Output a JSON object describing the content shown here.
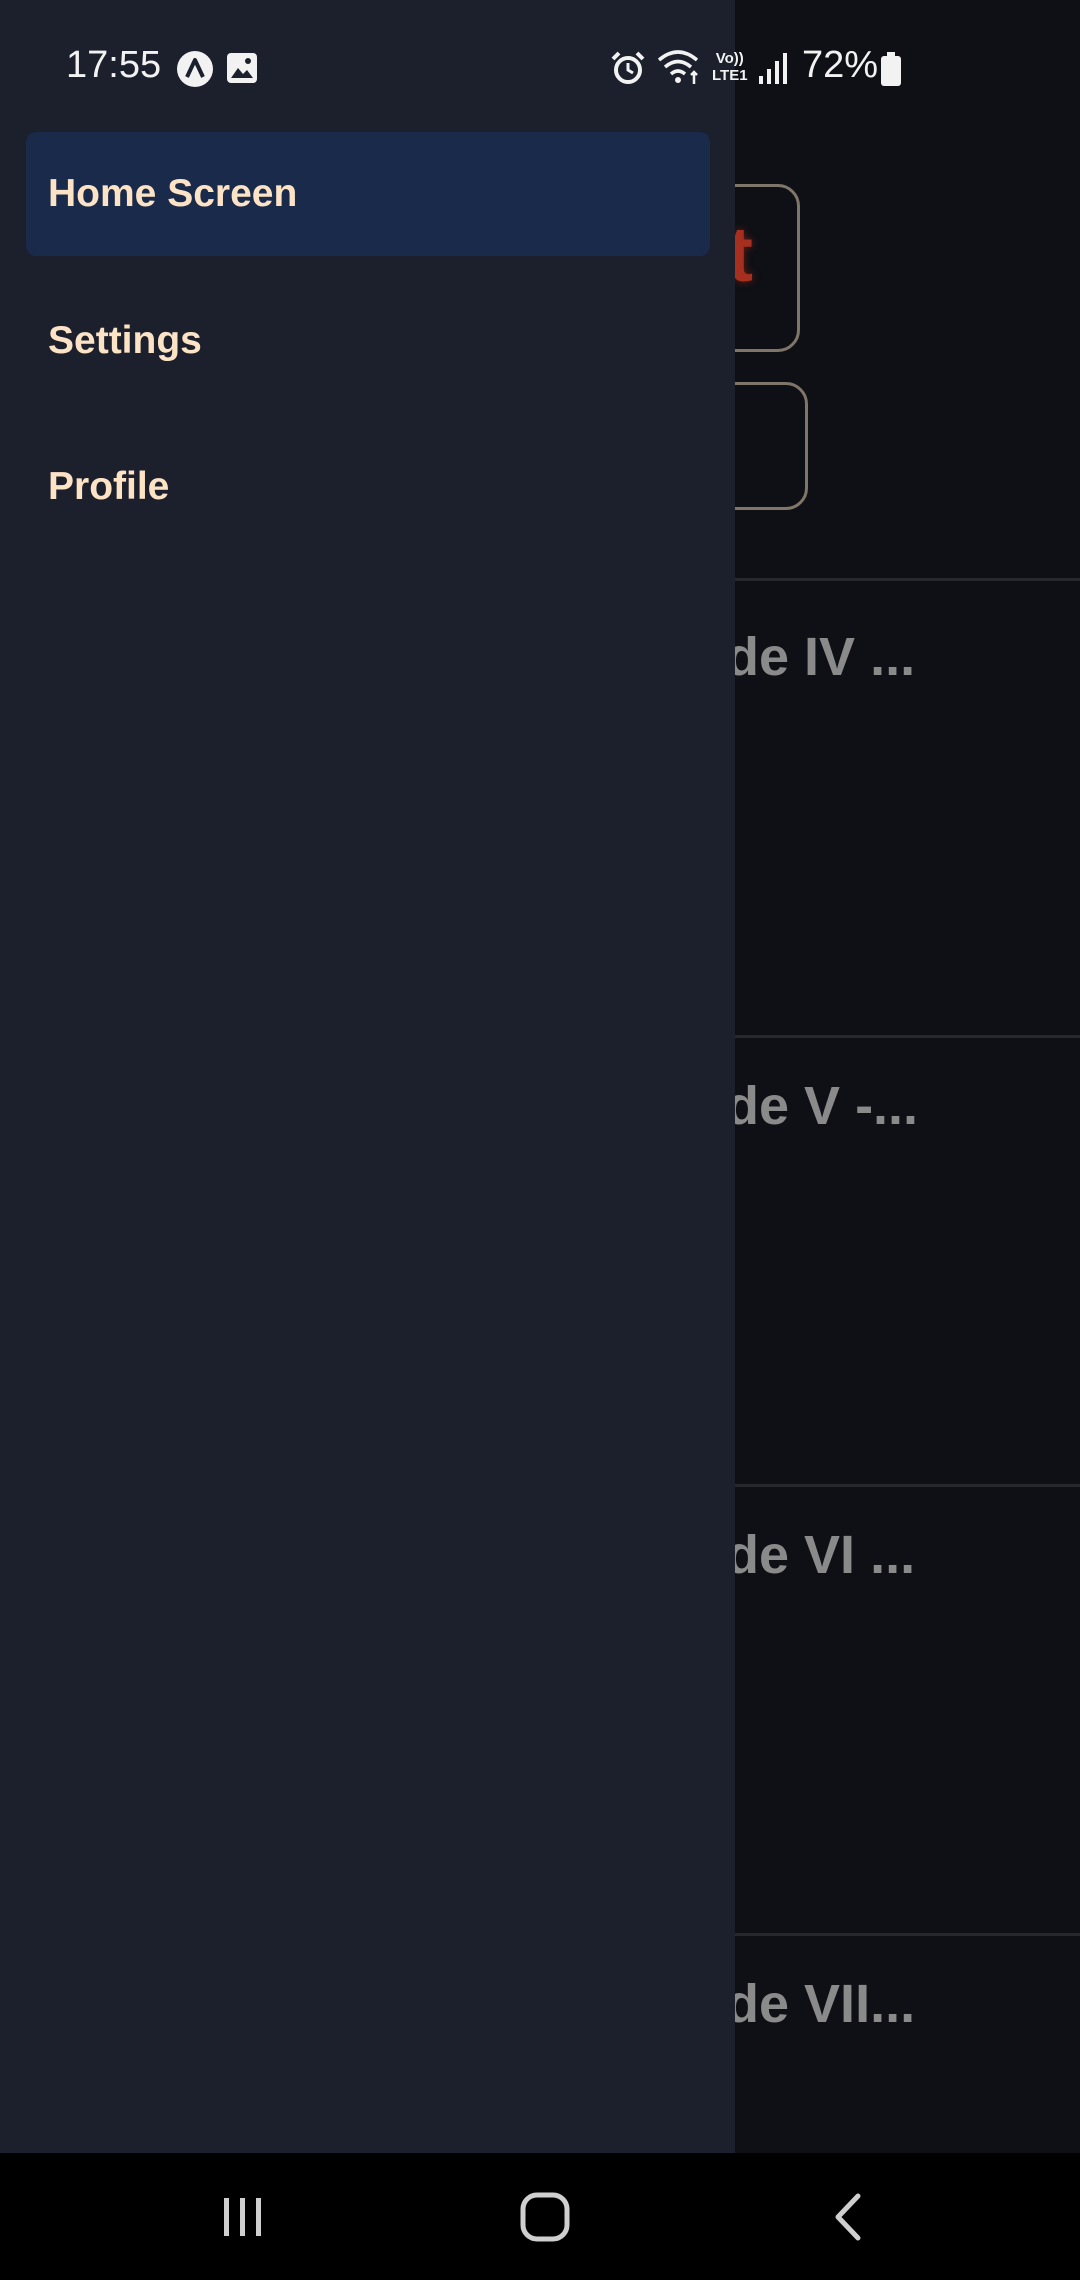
{
  "status_bar": {
    "time": "17:55",
    "battery": "72%",
    "network_label_top": "Vo))",
    "network_label_bottom": "LTE1",
    "left_icons": [
      "app-notification-icon",
      "image-icon"
    ],
    "right_icons": [
      "alarm-icon",
      "wifi-icon",
      "signal-icon",
      "battery-icon"
    ]
  },
  "drawer": {
    "items": [
      {
        "label": "Home Screen",
        "active": true
      },
      {
        "label": "Settings",
        "active": false
      },
      {
        "label": "Profile",
        "active": false
      }
    ]
  },
  "background": {
    "episodes": [
      {
        "title": "Episode IV ..."
      },
      {
        "title": "Episode V -..."
      },
      {
        "title": "Episode VI ..."
      },
      {
        "title": "Episode VII..."
      }
    ],
    "button_partial_glyph": "t"
  },
  "nav_bar": {
    "buttons": [
      "recent-apps",
      "home",
      "back"
    ]
  },
  "colors": {
    "drawer_bg": "#1c1f2c",
    "active_item_bg": "#1a2a4a",
    "item_text": "#fde3c6",
    "episode_text": "#8a8a8a"
  }
}
